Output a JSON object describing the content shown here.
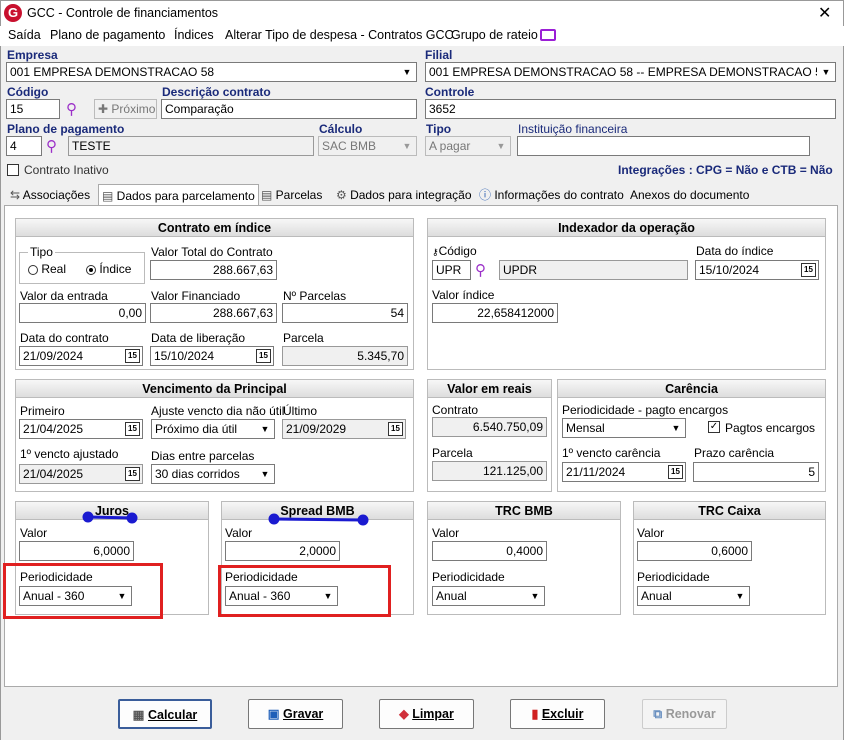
{
  "window": {
    "title": "GCC - Controle de financiamentos",
    "logo": "G"
  },
  "menu": [
    "Saída",
    "Plano de pagamento",
    "Índices",
    "Alterar Tipo de despesa - Contratos GCC",
    "Grupo de rateio"
  ],
  "header": {
    "empresa_label": "Empresa",
    "empresa_value": "001 EMPRESA DEMONSTRACAO 58",
    "filial_label": "Filial",
    "filial_value": "001 EMPRESA DEMONSTRACAO 58 -- EMPRESA DEMONSTRACAO 58",
    "codigo_label": "Código",
    "codigo_value": "15",
    "proximo_label": "Próximo",
    "descricao_label": "Descrição contrato",
    "descricao_value": "Comparação",
    "controle_label": "Controle",
    "controle_value": "3652",
    "plano_label": "Plano de pagamento",
    "plano_code": "4",
    "plano_name": "TESTE",
    "calculo_label": "Cálculo",
    "calculo_value": "SAC BMB",
    "tipo_label": "Tipo",
    "tipo_value": "A pagar",
    "instituicao_label": "Instituição financeira",
    "instituicao_value": "",
    "inativo_label": "Contrato Inativo",
    "integracoes": "Integrações : CPG = Não e CTB = Não"
  },
  "tabs": [
    "Associações",
    "Dados para parcelamento",
    "Parcelas",
    "Dados para integração",
    "Informações do contrato",
    "Anexos do documento"
  ],
  "contrato": {
    "title": "Contrato em índice",
    "tipo_label": "Tipo",
    "real_label": "Real",
    "indice_label": "Índice",
    "valor_total_label": "Valor Total do Contrato",
    "valor_total": "288.667,63",
    "valor_entrada_label": "Valor da entrada",
    "valor_entrada": "0,00",
    "valor_financiado_label": "Valor Financiado",
    "valor_financiado": "288.667,63",
    "nparcelas_label": "Nº Parcelas",
    "nparcelas": "54",
    "data_contrato_label": "Data do contrato",
    "data_contrato": "21/09/2024",
    "data_liberacao_label": "Data de liberação",
    "data_liberacao": "15/10/2024",
    "parcela_label": "Parcela",
    "parcela": "5.345,70"
  },
  "indexador": {
    "title": "Indexador da operação",
    "codigo_label": "Código",
    "codigo": "UPR",
    "nome": "UPDR",
    "data_indice_label": "Data do índice",
    "data_indice": "15/10/2024",
    "valor_indice_label": "Valor índice",
    "valor_indice": "22,658412000"
  },
  "vencimento": {
    "title": "Vencimento da Principal",
    "primeiro_label": "Primeiro",
    "primeiro": "21/04/2025",
    "ajuste_label": "Ajuste vencto dia não útil",
    "ajuste": "Próximo dia útil",
    "ultimo_label": "Último",
    "ultimo": "21/09/2029",
    "ajustado_label": "1º vencto ajustado",
    "ajustado": "21/04/2025",
    "dias_label": "Dias entre parcelas",
    "dias": "30 dias corridos"
  },
  "valor_reais": {
    "title": "Valor em reais",
    "contrato_label": "Contrato",
    "contrato": "6.540.750,09",
    "parcela_label": "Parcela",
    "parcela": "121.125,00"
  },
  "carencia": {
    "title": "Carência",
    "period_label": "Periodicidade - pagto encargos",
    "period": "Mensal",
    "pagtos_label": "Pagtos encargos",
    "venc_label": "1º vencto carência",
    "venc": "21/11/2024",
    "prazo_label": "Prazo carência",
    "prazo": "5"
  },
  "juros": {
    "title": "Juros",
    "valor_label": "Valor",
    "valor": "6,0000",
    "period_label": "Periodicidade",
    "period": "Anual - 360"
  },
  "spread": {
    "title": "Spread BMB",
    "valor_label": "Valor",
    "valor": "2,0000",
    "period_label": "Periodicidade",
    "period": "Anual - 360"
  },
  "trc_bmb": {
    "title": "TRC BMB",
    "valor_label": "Valor",
    "valor": "0,4000",
    "period_label": "Periodicidade",
    "period": "Anual"
  },
  "trc_caixa": {
    "title": "TRC Caixa",
    "valor_label": "Valor",
    "valor": "0,6000",
    "period_label": "Periodicidade",
    "period": "Anual"
  },
  "buttons": {
    "calcular": "Calcular",
    "gravar": "Gravar",
    "limpar": "Limpar",
    "excluir": "Excluir",
    "renovar": "Renovar"
  },
  "calendar_glyph": "15",
  "colors": {
    "accent": "#c8102e",
    "label_blue": "#1a2a7a",
    "annotation_red": "#e02020",
    "annotation_blue": "#1a1ad0"
  }
}
